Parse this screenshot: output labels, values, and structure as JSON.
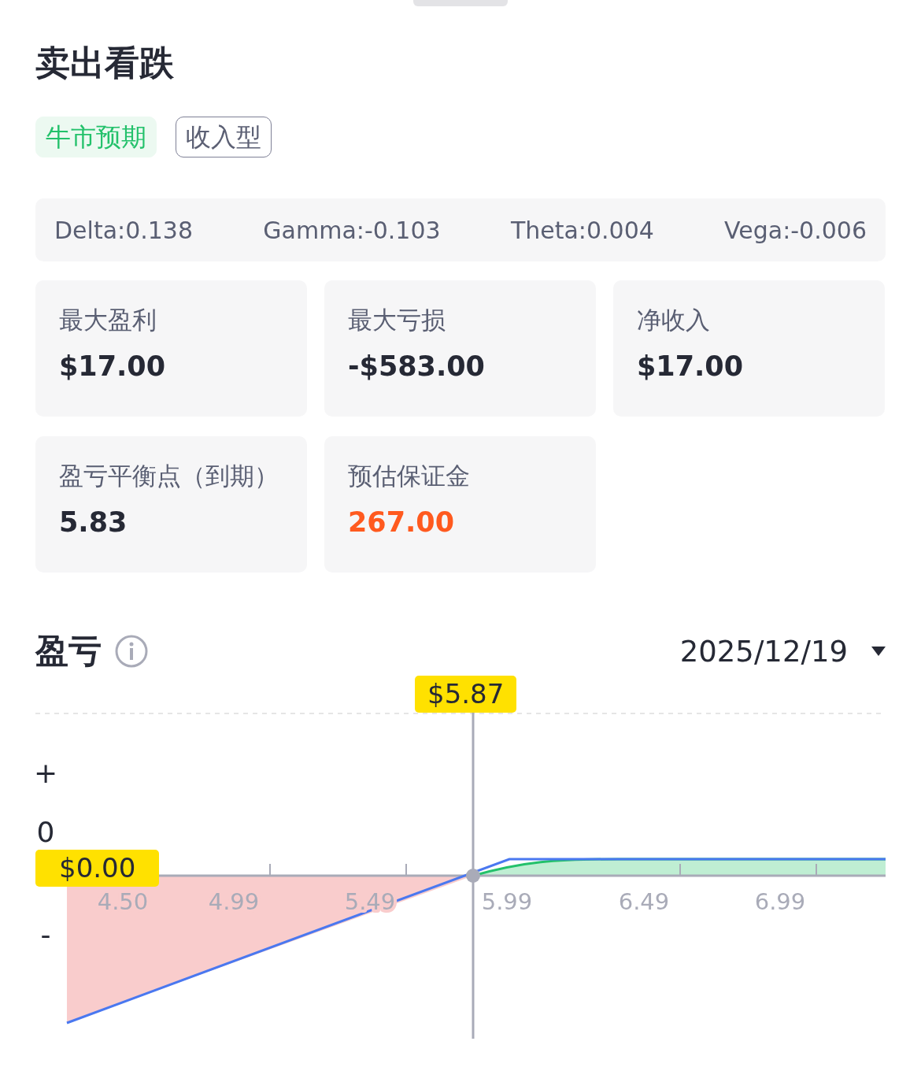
{
  "title": "卖出看跌",
  "tags": [
    {
      "label": "牛市预期",
      "kind": "filled"
    },
    {
      "label": "收入型",
      "kind": "outlined"
    }
  ],
  "greeks": [
    "Delta:0.138",
    "Gamma:-0.103",
    "Theta:0.004",
    "Vega:-0.006"
  ],
  "stats": [
    {
      "label": "最大盈利",
      "value": "$17.00",
      "kind": "normal"
    },
    {
      "label": "最大亏损",
      "value": "-$583.00",
      "kind": "normal"
    },
    {
      "label": "净收入",
      "value": "$17.00",
      "kind": "normal"
    },
    {
      "label": "盈亏平衡点（到期）",
      "value": "5.83",
      "kind": "normal"
    },
    {
      "label": "预估保证金",
      "value": "267.00",
      "kind": "highlight"
    }
  ],
  "pnl": {
    "title": "盈亏",
    "date": "2025/12/19",
    "y_labels": [
      "+",
      "0",
      "-"
    ],
    "x_ticks": [
      "4.50",
      "4.99",
      "5.49",
      "5.99",
      "6.49",
      "6.99"
    ],
    "price_marker": "$5.87",
    "value_marker": "$0.00"
  }
}
